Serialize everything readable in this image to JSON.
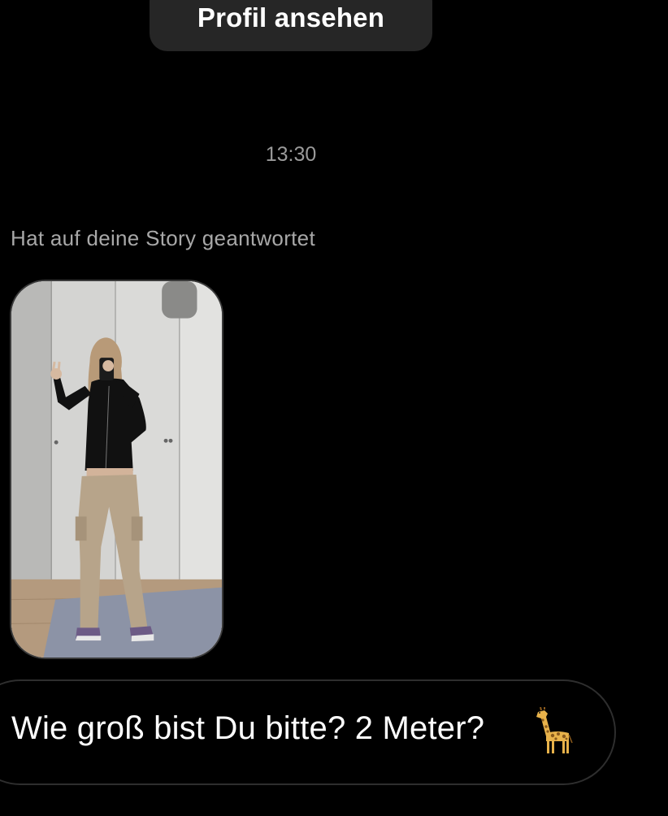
{
  "header": {
    "profile_button_label": "Profil ansehen"
  },
  "conversation": {
    "timestamp": "13:30",
    "story_reply_note": "Hat auf deine Story geantwortet",
    "story_thumbnail": "story-photo-mirror-selfie",
    "message_text": "Wie groß bist Du bitte? 2 Meter?",
    "message_emoji": "giraffe-emoji"
  },
  "colors": {
    "background": "#000000",
    "button_bg": "#262626",
    "muted_text": "#a8a8a8",
    "bubble_border": "#2e2e2e"
  }
}
